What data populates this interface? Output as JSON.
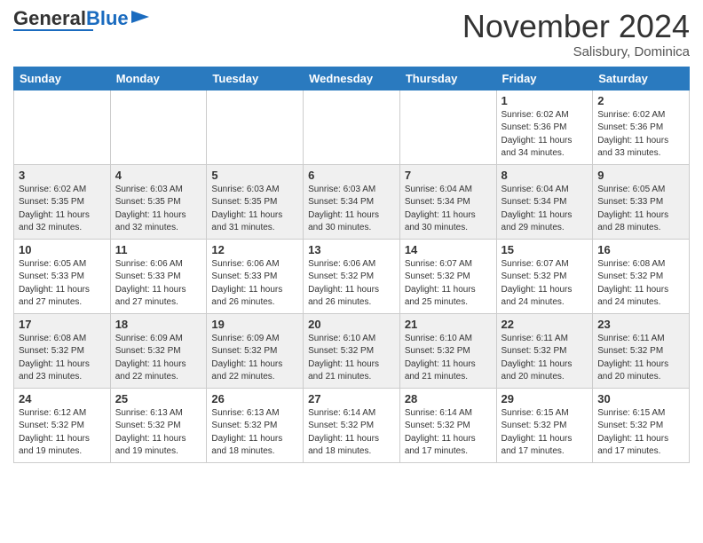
{
  "header": {
    "logo_general": "General",
    "logo_blue": "Blue",
    "month_title": "November 2024",
    "location": "Salisbury, Dominica"
  },
  "days_of_week": [
    "Sunday",
    "Monday",
    "Tuesday",
    "Wednesday",
    "Thursday",
    "Friday",
    "Saturday"
  ],
  "weeks": [
    [
      {
        "day": "",
        "info": ""
      },
      {
        "day": "",
        "info": ""
      },
      {
        "day": "",
        "info": ""
      },
      {
        "day": "",
        "info": ""
      },
      {
        "day": "",
        "info": ""
      },
      {
        "day": "1",
        "info": "Sunrise: 6:02 AM\nSunset: 5:36 PM\nDaylight: 11 hours\nand 34 minutes."
      },
      {
        "day": "2",
        "info": "Sunrise: 6:02 AM\nSunset: 5:36 PM\nDaylight: 11 hours\nand 33 minutes."
      }
    ],
    [
      {
        "day": "3",
        "info": "Sunrise: 6:02 AM\nSunset: 5:35 PM\nDaylight: 11 hours\nand 32 minutes."
      },
      {
        "day": "4",
        "info": "Sunrise: 6:03 AM\nSunset: 5:35 PM\nDaylight: 11 hours\nand 32 minutes."
      },
      {
        "day": "5",
        "info": "Sunrise: 6:03 AM\nSunset: 5:35 PM\nDaylight: 11 hours\nand 31 minutes."
      },
      {
        "day": "6",
        "info": "Sunrise: 6:03 AM\nSunset: 5:34 PM\nDaylight: 11 hours\nand 30 minutes."
      },
      {
        "day": "7",
        "info": "Sunrise: 6:04 AM\nSunset: 5:34 PM\nDaylight: 11 hours\nand 30 minutes."
      },
      {
        "day": "8",
        "info": "Sunrise: 6:04 AM\nSunset: 5:34 PM\nDaylight: 11 hours\nand 29 minutes."
      },
      {
        "day": "9",
        "info": "Sunrise: 6:05 AM\nSunset: 5:33 PM\nDaylight: 11 hours\nand 28 minutes."
      }
    ],
    [
      {
        "day": "10",
        "info": "Sunrise: 6:05 AM\nSunset: 5:33 PM\nDaylight: 11 hours\nand 27 minutes."
      },
      {
        "day": "11",
        "info": "Sunrise: 6:06 AM\nSunset: 5:33 PM\nDaylight: 11 hours\nand 27 minutes."
      },
      {
        "day": "12",
        "info": "Sunrise: 6:06 AM\nSunset: 5:33 PM\nDaylight: 11 hours\nand 26 minutes."
      },
      {
        "day": "13",
        "info": "Sunrise: 6:06 AM\nSunset: 5:32 PM\nDaylight: 11 hours\nand 26 minutes."
      },
      {
        "day": "14",
        "info": "Sunrise: 6:07 AM\nSunset: 5:32 PM\nDaylight: 11 hours\nand 25 minutes."
      },
      {
        "day": "15",
        "info": "Sunrise: 6:07 AM\nSunset: 5:32 PM\nDaylight: 11 hours\nand 24 minutes."
      },
      {
        "day": "16",
        "info": "Sunrise: 6:08 AM\nSunset: 5:32 PM\nDaylight: 11 hours\nand 24 minutes."
      }
    ],
    [
      {
        "day": "17",
        "info": "Sunrise: 6:08 AM\nSunset: 5:32 PM\nDaylight: 11 hours\nand 23 minutes."
      },
      {
        "day": "18",
        "info": "Sunrise: 6:09 AM\nSunset: 5:32 PM\nDaylight: 11 hours\nand 22 minutes."
      },
      {
        "day": "19",
        "info": "Sunrise: 6:09 AM\nSunset: 5:32 PM\nDaylight: 11 hours\nand 22 minutes."
      },
      {
        "day": "20",
        "info": "Sunrise: 6:10 AM\nSunset: 5:32 PM\nDaylight: 11 hours\nand 21 minutes."
      },
      {
        "day": "21",
        "info": "Sunrise: 6:10 AM\nSunset: 5:32 PM\nDaylight: 11 hours\nand 21 minutes."
      },
      {
        "day": "22",
        "info": "Sunrise: 6:11 AM\nSunset: 5:32 PM\nDaylight: 11 hours\nand 20 minutes."
      },
      {
        "day": "23",
        "info": "Sunrise: 6:11 AM\nSunset: 5:32 PM\nDaylight: 11 hours\nand 20 minutes."
      }
    ],
    [
      {
        "day": "24",
        "info": "Sunrise: 6:12 AM\nSunset: 5:32 PM\nDaylight: 11 hours\nand 19 minutes."
      },
      {
        "day": "25",
        "info": "Sunrise: 6:13 AM\nSunset: 5:32 PM\nDaylight: 11 hours\nand 19 minutes."
      },
      {
        "day": "26",
        "info": "Sunrise: 6:13 AM\nSunset: 5:32 PM\nDaylight: 11 hours\nand 18 minutes."
      },
      {
        "day": "27",
        "info": "Sunrise: 6:14 AM\nSunset: 5:32 PM\nDaylight: 11 hours\nand 18 minutes."
      },
      {
        "day": "28",
        "info": "Sunrise: 6:14 AM\nSunset: 5:32 PM\nDaylight: 11 hours\nand 17 minutes."
      },
      {
        "day": "29",
        "info": "Sunrise: 6:15 AM\nSunset: 5:32 PM\nDaylight: 11 hours\nand 17 minutes."
      },
      {
        "day": "30",
        "info": "Sunrise: 6:15 AM\nSunset: 5:32 PM\nDaylight: 11 hours\nand 17 minutes."
      }
    ]
  ]
}
